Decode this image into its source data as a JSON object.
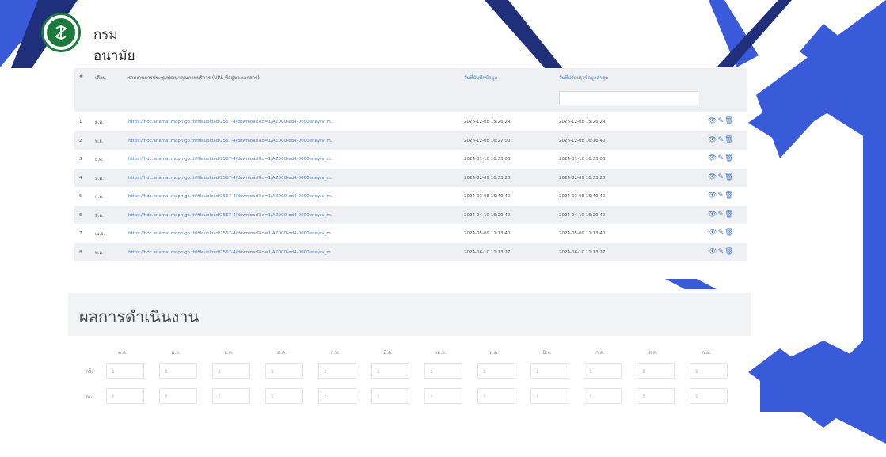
{
  "header": {
    "org_name": "กรมอนามัย"
  },
  "table": {
    "columns": {
      "num": "#",
      "month": "เดือน",
      "url": "รายงานการประชุมพัฒนาคุณภาพบริการ (URL ที่อยู่ของเอกสาร)",
      "created": "วันที่บันทึกข้อมูล",
      "updated": "วันที่ปรับปรุงข้อมูลล่าสุด"
    },
    "rows": [
      {
        "num": "1",
        "month": "ต.ค.",
        "url": "https://hdc.anamai.moph.go.th/fileupload/2567-4/download?id=1/AZ0C0-ed4-0000eneyrv_m.",
        "created": "2023-12-08 15:26:24",
        "updated": "2023-12-08 15:26:24"
      },
      {
        "num": "2",
        "month": "พ.ย.",
        "url": "https://hdc.anamai.moph.go.th/fileupload/2567-4/download?id=1/AZ0C0-ed4-0000eneyrv_m.",
        "created": "2023-12-08 16:27:00",
        "updated": "2023-12-08 16:16:40"
      },
      {
        "num": "3",
        "month": "ธ.ค.",
        "url": "https://hdc.anamai.moph.go.th/fileupload/2567-4/download?id=1/AZ0C0-ed4-0000eneyrv_m.",
        "created": "2024-01-10 10:33:06",
        "updated": "2024-01-10 10:33:06"
      },
      {
        "num": "4",
        "month": "ม.ค.",
        "url": "https://hdc.anamai.moph.go.th/fileupload/2567-4/download?id=1/AZ0C0-ed4-0000eneyrv_m.",
        "created": "2024-02-09 10:33:20",
        "updated": "2024-02-09 10:33:20"
      },
      {
        "num": "5",
        "month": "ก.พ.",
        "url": "https://hdc.anamai.moph.go.th/fileupload/2567-4/download?id=1/AZ0C0-ed4-0000eneyrv_m.",
        "created": "2024-03-08 15:49:40",
        "updated": "2024-03-08 15:49:40"
      },
      {
        "num": "6",
        "month": "มี.ค.",
        "url": "https://hdc.anamai.moph.go.th/fileupload/2567-4/download?id=1/AZ0C0-ed4-0000eneyrv_m.",
        "created": "2024-04-10 16:29:40",
        "updated": "2024-04-10 16:29:40"
      },
      {
        "num": "7",
        "month": "เม.ย.",
        "url": "https://hdc.anamai.moph.go.th/fileupload/2567-4/download?id=1/AZ0C0-ed4-0000eneyrv_m.",
        "created": "2024-05-09 11:13:40",
        "updated": "2024-05-09 11:13:40"
      },
      {
        "num": "8",
        "month": "พ.ค.",
        "url": "https://hdc.anamai.moph.go.th/fileupload/2567-4/download?id=1/AZ0C0-ed4-0000eneyrv_m.",
        "created": "2024-06-10 11:13:27",
        "updated": "2024-06-10 11:13:27"
      }
    ],
    "row_actions": [
      "eye-icon",
      "pencil-icon",
      "trash-icon"
    ]
  },
  "results": {
    "title": "ผลการดำเนินงาน",
    "months": [
      "ต.ค.",
      "พ.ย.",
      "ธ.ค.",
      "ม.ค.",
      "ก.พ.",
      "มี.ค.",
      "เม.ย.",
      "พ.ค.",
      "มิ.ย.",
      "ก.ค.",
      "ส.ค.",
      "ก.ย."
    ],
    "rows": [
      {
        "label": "ครั้ง",
        "values": [
          "1",
          "1",
          "1",
          "1",
          "1",
          "1",
          "1",
          "1",
          "1",
          "1",
          "1",
          "1"
        ]
      },
      {
        "label": "คน",
        "values": [
          "1",
          "1",
          "1",
          "1",
          "1",
          "1",
          "1",
          "1",
          "1",
          "1",
          "1",
          "1"
        ]
      }
    ]
  },
  "colors": {
    "primary_blue": "#3a5bd9",
    "navy": "#1f2f7a",
    "link": "#4a7fc1",
    "logo_green": "#1d7a3d"
  }
}
